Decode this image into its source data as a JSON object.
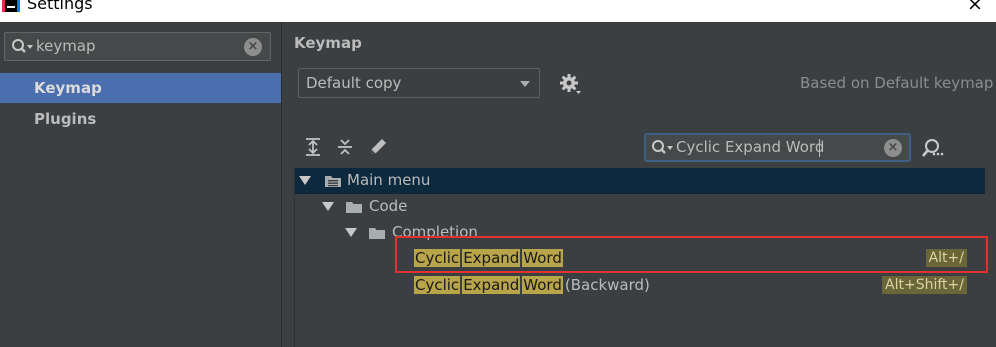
{
  "window": {
    "title": "Settings",
    "close_glyph": "×"
  },
  "sidebar": {
    "search": {
      "value": "keymap",
      "icon": "search-icon",
      "clear_glyph": "×"
    },
    "items": [
      {
        "label": "Keymap",
        "selected": true
      },
      {
        "label": "Plugins",
        "selected": false
      }
    ]
  },
  "main": {
    "title": "Keymap",
    "keymap_select": {
      "value": "Default copy"
    },
    "based_on": "Based on Default keymap",
    "filter": {
      "value": "Cyclic Expand Word",
      "clear_glyph": "×"
    },
    "toolbar_icons": [
      "expand-all-icon",
      "collapse-all-icon",
      "edit-icon"
    ],
    "tree": {
      "main_menu": "Main menu",
      "code": "Code",
      "completion": "Completion",
      "actions": [
        {
          "words": [
            "Cyclic",
            "Expand",
            "Word"
          ],
          "suffix": "",
          "shortcut": "Alt+/"
        },
        {
          "words": [
            "Cyclic",
            "Expand",
            "Word"
          ],
          "suffix": "(Backward)",
          "shortcut": "Alt+Shift+/"
        }
      ]
    }
  },
  "colors": {
    "background": "#3c3f41",
    "selection": "#4b6eaf",
    "tree_selection": "#0d293e",
    "match_highlight": "#b8a449",
    "annotation_box": "#e0322e"
  }
}
